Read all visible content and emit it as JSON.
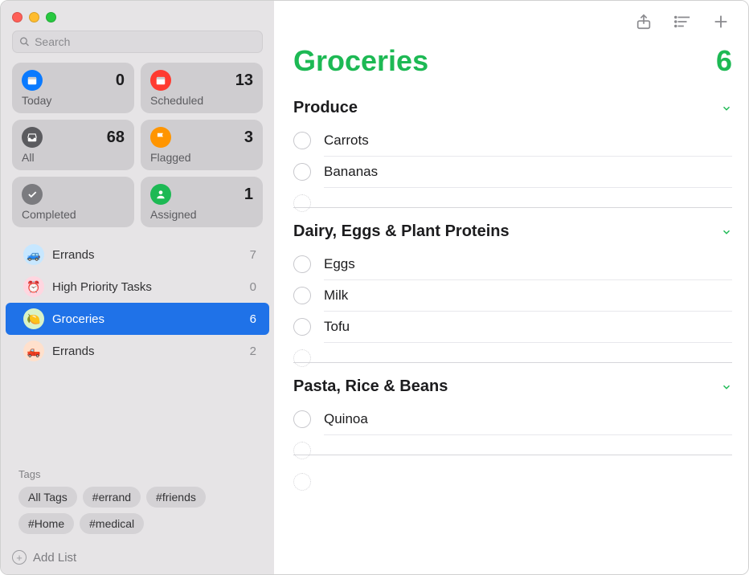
{
  "search": {
    "placeholder": "Search"
  },
  "smart_lists": [
    {
      "id": "today",
      "label": "Today",
      "count": 0,
      "bg": "#0a7aff",
      "icon": "calendar"
    },
    {
      "id": "scheduled",
      "label": "Scheduled",
      "count": 13,
      "bg": "#ff3b30",
      "icon": "calendar"
    },
    {
      "id": "all",
      "label": "All",
      "count": 68,
      "bg": "#5b5b5f",
      "icon": "tray"
    },
    {
      "id": "flagged",
      "label": "Flagged",
      "count": 3,
      "bg": "#ff9500",
      "icon": "flag"
    },
    {
      "id": "completed",
      "label": "Completed",
      "count": "",
      "bg": "#7b7b7f",
      "icon": "check"
    },
    {
      "id": "assigned",
      "label": "Assigned",
      "count": 1,
      "bg": "#1db954",
      "icon": "person"
    }
  ],
  "lists": [
    {
      "id": "errands1",
      "label": "Errands",
      "count": 7,
      "emoji": "🚙",
      "bg": "#c7e7ff",
      "selected": false
    },
    {
      "id": "highpri",
      "label": "High Priority Tasks",
      "count": 0,
      "emoji": "⏰",
      "bg": "#ffd6e0",
      "selected": false
    },
    {
      "id": "groceries",
      "label": "Groceries",
      "count": 6,
      "emoji": "🍋",
      "bg": "#d9f2c7",
      "selected": true
    },
    {
      "id": "errands2",
      "label": "Errands",
      "count": 2,
      "emoji": "🛻",
      "bg": "#ffe0cc",
      "selected": false
    }
  ],
  "tags": {
    "title": "Tags",
    "items": [
      "All Tags",
      "#errand",
      "#friends",
      "#Home",
      "#medical"
    ]
  },
  "add_list_label": "Add List",
  "main": {
    "title": "Groceries",
    "count": 6,
    "accent": "#1db954",
    "sections": [
      {
        "title": "Produce",
        "items": [
          "Carrots",
          "Bananas"
        ]
      },
      {
        "title": "Dairy, Eggs & Plant Proteins",
        "items": [
          "Eggs",
          "Milk",
          "Tofu"
        ]
      },
      {
        "title": "Pasta, Rice & Beans",
        "items": [
          "Quinoa"
        ]
      }
    ]
  }
}
